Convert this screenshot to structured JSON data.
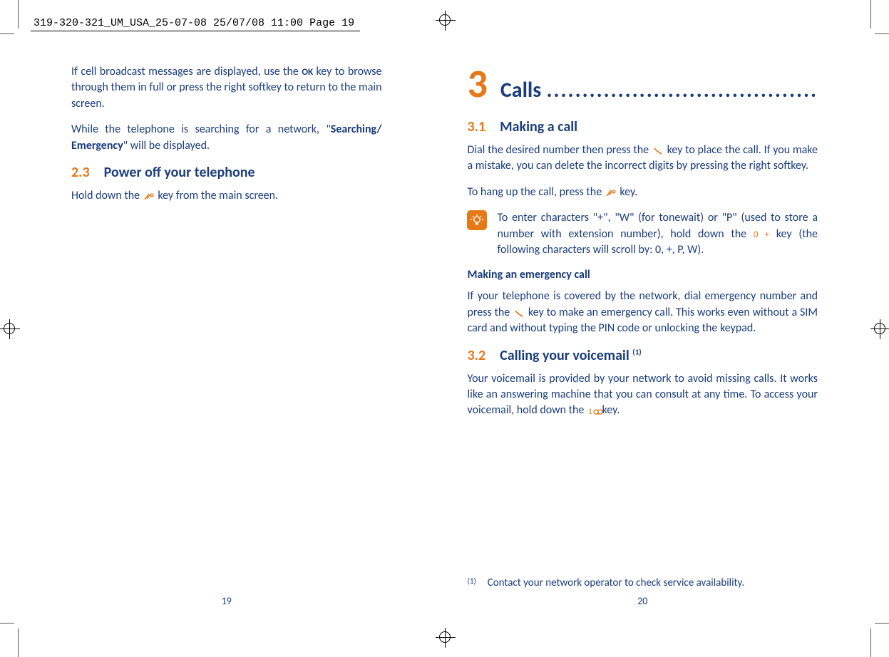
{
  "header": {
    "fileInfo": "319-320-321_UM_USA_25-07-08  25/07/08  11:00  Page 19"
  },
  "leftPage": {
    "para1_a": "If cell broadcast messages are displayed, use the ",
    "para1_ok": "OK",
    "para1_b": " key to browse through them in full or press the right softkey to return to the main screen.",
    "para2_a": "While the telephone is searching for a network, \"",
    "para2_bold": "Searching/ Emergency",
    "para2_b": "\" will be displayed.",
    "heading23_num": "2.3",
    "heading23_title": "Power off your telephone",
    "para3_a": "Hold down the ",
    "para3_b": " key from the main screen.",
    "pageNum": "19"
  },
  "rightPage": {
    "chapterNum": "3",
    "chapterTitle": "Calls",
    "chapterDots": "......................................",
    "heading31_num": "3.1",
    "heading31_title": "Making a call",
    "para1_a": "Dial the desired number then press the ",
    "para1_b": " key to place the call. If you make a mistake, you can delete the incorrect digits by pressing the right softkey.",
    "para2_a": "To hang up the call, press the ",
    "para2_b": " key.",
    "tip_a": "To enter characters \"+\", \"W\" (for tonewait) or \"P\" (used to store a number with extension number), hold down the ",
    "tip_key": "0 +",
    "tip_b": " key (the following characters will scroll by: 0, +, P, W).",
    "subHeading": "Making an emergency call",
    "para3_a": "If your telephone is covered by the network, dial emergency number and press the ",
    "para3_b": " key to make an emergency call. This works even without a SIM card and without typing the PIN code or unlocking the keypad.",
    "heading32_num": "3.2",
    "heading32_title": "Calling your voicemail ",
    "heading32_ref": "(1)",
    "para4_a": "Your voicemail is provided by your network to avoid missing calls. It works like an answering machine that you can consult at any time. To access your voicemail, hold down the ",
    "para4_b": " key.",
    "footnote_marker": "(1)",
    "footnote_text": "Contact your network operator to check service availability.",
    "pageNum": "20"
  }
}
